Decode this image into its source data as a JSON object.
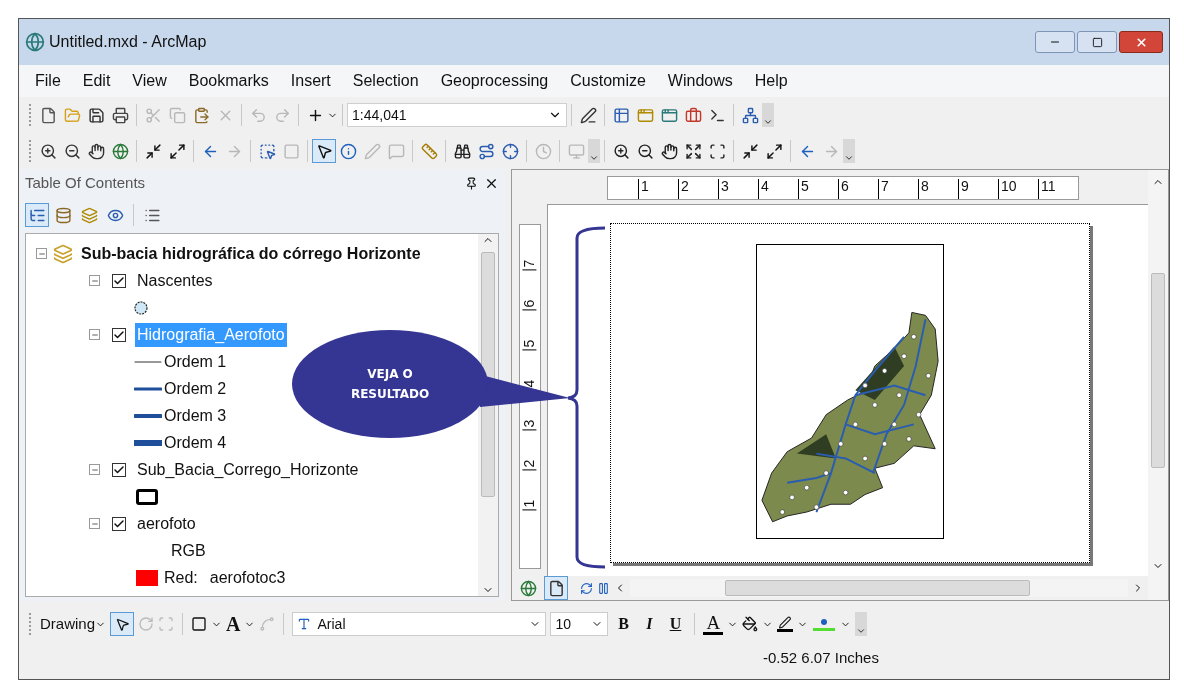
{
  "window": {
    "title": "Untitled.mxd - ArcMap"
  },
  "menu": [
    "File",
    "Edit",
    "View",
    "Bookmarks",
    "Insert",
    "Selection",
    "Geoprocessing",
    "Customize",
    "Windows",
    "Help"
  ],
  "toolbar_standard": [
    {
      "kind": "new",
      "disabled": false
    },
    {
      "kind": "open",
      "disabled": false
    },
    {
      "kind": "save",
      "disabled": false
    },
    {
      "kind": "print",
      "disabled": false
    },
    {
      "kind": "sep"
    },
    {
      "kind": "cut",
      "disabled": true
    },
    {
      "kind": "copy",
      "disabled": true
    },
    {
      "kind": "paste",
      "disabled": false
    },
    {
      "kind": "delete",
      "disabled": true
    },
    {
      "kind": "sep"
    },
    {
      "kind": "undo",
      "disabled": true
    },
    {
      "kind": "redo",
      "disabled": true
    },
    {
      "kind": "sep"
    },
    {
      "kind": "add-data",
      "disabled": false
    },
    {
      "kind": "sep"
    },
    {
      "kind": "scale",
      "value": "1:44,041"
    },
    {
      "kind": "sep"
    },
    {
      "kind": "editor",
      "disabled": false
    },
    {
      "kind": "sep"
    },
    {
      "kind": "table",
      "disabled": false
    },
    {
      "kind": "catalog",
      "disabled": false
    },
    {
      "kind": "search-window",
      "disabled": false
    },
    {
      "kind": "toolbox",
      "disabled": false
    },
    {
      "kind": "python",
      "disabled": false
    },
    {
      "kind": "sep"
    },
    {
      "kind": "model",
      "disabled": false
    },
    {
      "kind": "overflow"
    }
  ],
  "toolbar_tools": [
    {
      "kind": "zoom-in",
      "selected": false,
      "disabled": false
    },
    {
      "kind": "zoom-out",
      "selected": false,
      "disabled": false
    },
    {
      "kind": "pan",
      "selected": false,
      "disabled": false
    },
    {
      "kind": "full-extent",
      "selected": false,
      "disabled": false
    },
    {
      "kind": "sep"
    },
    {
      "kind": "fixed-zoom-in",
      "selected": false,
      "disabled": false
    },
    {
      "kind": "fixed-zoom-out",
      "selected": false,
      "disabled": false
    },
    {
      "kind": "sep"
    },
    {
      "kind": "back",
      "selected": false,
      "disabled": false
    },
    {
      "kind": "forward",
      "selected": false,
      "disabled": true
    },
    {
      "kind": "sep"
    },
    {
      "kind": "select-features",
      "selected": false,
      "disabled": false
    },
    {
      "kind": "clear-selection",
      "selected": false,
      "disabled": true
    },
    {
      "kind": "sep"
    },
    {
      "kind": "pointer",
      "selected": true,
      "disabled": false
    },
    {
      "kind": "identify",
      "selected": false,
      "disabled": false
    },
    {
      "kind": "hyperlink",
      "selected": false,
      "disabled": true
    },
    {
      "kind": "html-popup",
      "selected": false,
      "disabled": true
    },
    {
      "kind": "sep"
    },
    {
      "kind": "measure",
      "selected": false,
      "disabled": false
    },
    {
      "kind": "sep"
    },
    {
      "kind": "find",
      "selected": false,
      "disabled": false
    },
    {
      "kind": "route",
      "selected": false,
      "disabled": false
    },
    {
      "kind": "go-to-xy",
      "selected": false,
      "disabled": false
    },
    {
      "kind": "sep"
    },
    {
      "kind": "time-slider",
      "selected": false,
      "disabled": true
    },
    {
      "kind": "sep"
    },
    {
      "kind": "viewer",
      "selected": false,
      "disabled": true
    },
    {
      "kind": "overflow"
    },
    {
      "kind": "sep"
    },
    {
      "kind": "page-zoom-in",
      "selected": false,
      "disabled": false
    },
    {
      "kind": "page-zoom-out",
      "selected": false,
      "disabled": false
    },
    {
      "kind": "page-pan",
      "selected": false,
      "disabled": false
    },
    {
      "kind": "zoom-whole-page",
      "selected": false,
      "disabled": false
    },
    {
      "kind": "zoom-100",
      "selected": false,
      "disabled": false
    },
    {
      "kind": "sep"
    },
    {
      "kind": "fixed-zoom-in",
      "selected": false,
      "disabled": false
    },
    {
      "kind": "fixed-zoom-out",
      "selected": false,
      "disabled": false
    },
    {
      "kind": "sep"
    },
    {
      "kind": "back",
      "selected": false,
      "disabled": false
    },
    {
      "kind": "forward",
      "selected": false,
      "disabled": true
    },
    {
      "kind": "overflow"
    }
  ],
  "toc": {
    "title": "Table Of Contents",
    "tabs": [
      {
        "kind": "drawing-order",
        "selected": true
      },
      {
        "kind": "source",
        "selected": false
      },
      {
        "kind": "visibility",
        "selected": false
      },
      {
        "kind": "selection",
        "selected": false
      },
      {
        "kind": "options",
        "selected": false
      }
    ],
    "tree": [
      {
        "label": "Sub-bacia hidrográfica do córrego Horizonte",
        "expanded": true,
        "children": [
          {
            "label": "Nascentes",
            "expanded": true,
            "checked": true,
            "selected": false,
            "legend": [
              {
                "kind": "point"
              }
            ]
          },
          {
            "label": "Hidrografia_Aerofoto",
            "expanded": true,
            "checked": true,
            "selected": true,
            "legend": [
              {
                "kind": "thin",
                "label": "Ordem 1"
              },
              {
                "kind": "medium",
                "label": "Ordem 2"
              },
              {
                "kind": "thick",
                "label": "Ordem 3"
              },
              {
                "kind": "heavy",
                "label": "Ordem 4"
              }
            ]
          },
          {
            "label": "Sub_Bacia_Corrego_Horizonte",
            "expanded": true,
            "checked": true,
            "selected": false,
            "legend": [
              {
                "kind": "outline"
              }
            ]
          },
          {
            "label": "aerofoto",
            "expanded": true,
            "checked": true,
            "selected": false,
            "legend": [
              {
                "kind": "heading",
                "label": "RGB"
              },
              {
                "kind": "band",
                "label": "Red:",
                "value": "aerofotoc3",
                "color": "#ff0000"
              }
            ]
          }
        ]
      }
    ]
  },
  "layout": {
    "hruler": [
      "1",
      "2",
      "3",
      "4",
      "5",
      "6",
      "7",
      "8",
      "9",
      "10",
      "11"
    ],
    "vruler": [
      "7",
      "6",
      "5",
      "4",
      "3",
      "2",
      "1"
    ],
    "view_buttons": [
      {
        "kind": "data-view",
        "selected": false
      },
      {
        "kind": "layout-view",
        "selected": true
      }
    ]
  },
  "callout": {
    "lines": [
      "VEJA O",
      "RESULTADO"
    ]
  },
  "drawing_toolbar": {
    "menu": "Drawing",
    "font": "Arial",
    "size": "10",
    "bold": "B",
    "italic": "I",
    "underline": "U",
    "font_color": "A",
    "text_tool": "A"
  },
  "status_bar": {
    "coordinates": "-0.52 6.07 Inches"
  }
}
